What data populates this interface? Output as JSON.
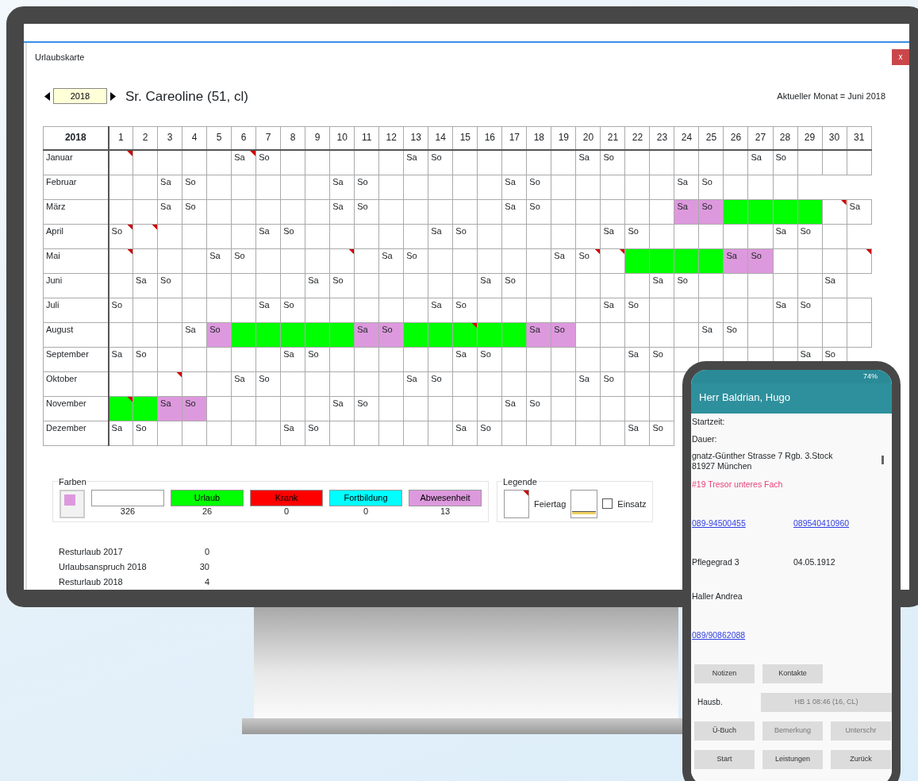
{
  "window": {
    "title": "Urlaubskarte",
    "close": "x"
  },
  "toolbar": {
    "year": "2018",
    "employee": "Sr. Careoline (51, cl)",
    "current_month": "Aktueller Monat = Juni 2018"
  },
  "calendar": {
    "corner": "2018",
    "columns": [
      "1",
      "2",
      "3",
      "4",
      "5",
      "6",
      "7",
      "8",
      "9",
      "10",
      "11",
      "12",
      "13",
      "14",
      "15",
      "16",
      "17",
      "18",
      "19",
      "20",
      "21",
      "22",
      "23",
      "24",
      "25",
      "26",
      "27",
      "28",
      "29",
      "30",
      "31"
    ],
    "months": [
      {
        "name": "Januar",
        "days": [
          {
            "kind": "none",
            "holiday": true
          },
          {
            "kind": "none",
            "holiday": false
          },
          {
            "kind": "none",
            "holiday": false
          },
          {
            "kind": "none",
            "holiday": false
          },
          {
            "kind": "none",
            "holiday": false
          },
          {
            "text": "Sa",
            "kind": "none",
            "holiday": true
          },
          {
            "text": "So",
            "kind": "none",
            "holiday": false
          },
          {
            "kind": "none",
            "holiday": false
          },
          {
            "kind": "none",
            "holiday": false
          },
          {
            "kind": "none",
            "holiday": false
          },
          {
            "kind": "none",
            "holiday": false
          },
          {
            "kind": "none",
            "holiday": false
          },
          {
            "text": "Sa",
            "kind": "none",
            "holiday": false
          },
          {
            "text": "So",
            "kind": "none",
            "holiday": false
          },
          {
            "kind": "none",
            "holiday": false
          },
          {
            "kind": "none",
            "holiday": false
          },
          {
            "kind": "none",
            "holiday": false
          },
          {
            "kind": "none",
            "holiday": false
          },
          {
            "kind": "none",
            "holiday": false
          },
          {
            "text": "Sa",
            "kind": "none",
            "holiday": false
          },
          {
            "text": "So",
            "kind": "none",
            "holiday": false
          },
          {
            "kind": "none",
            "holiday": false
          },
          {
            "kind": "none",
            "holiday": false
          },
          {
            "kind": "none",
            "holiday": false
          },
          {
            "kind": "none",
            "holiday": false
          },
          {
            "kind": "none",
            "holiday": false
          },
          {
            "text": "Sa",
            "kind": "none",
            "holiday": false
          },
          {
            "text": "So",
            "kind": "none",
            "holiday": false
          },
          {
            "kind": "none",
            "holiday": false
          },
          {
            "kind": "none",
            "holiday": false
          },
          {
            "kind": "none",
            "holiday": false
          }
        ]
      },
      {
        "name": "Februar",
        "days": [
          {
            "kind": "none",
            "holiday": false
          },
          {
            "kind": "none",
            "holiday": false
          },
          {
            "text": "Sa",
            "kind": "none",
            "holiday": false
          },
          {
            "text": "So",
            "kind": "none",
            "holiday": false
          },
          {
            "kind": "none",
            "holiday": false
          },
          {
            "kind": "none",
            "holiday": false
          },
          {
            "kind": "none",
            "holiday": false
          },
          {
            "kind": "none",
            "holiday": false
          },
          {
            "kind": "none",
            "holiday": false
          },
          {
            "text": "Sa",
            "kind": "none",
            "holiday": false
          },
          {
            "text": "So",
            "kind": "none",
            "holiday": false
          },
          {
            "kind": "none",
            "holiday": false
          },
          {
            "kind": "none",
            "holiday": false
          },
          {
            "kind": "none",
            "holiday": false
          },
          {
            "kind": "none",
            "holiday": false
          },
          {
            "kind": "none",
            "holiday": false
          },
          {
            "text": "Sa",
            "kind": "none",
            "holiday": false
          },
          {
            "text": "So",
            "kind": "none",
            "holiday": false
          },
          {
            "kind": "none",
            "holiday": false
          },
          {
            "kind": "none",
            "holiday": false
          },
          {
            "kind": "none",
            "holiday": false
          },
          {
            "kind": "none",
            "holiday": false
          },
          {
            "kind": "none",
            "holiday": false
          },
          {
            "text": "Sa",
            "kind": "none",
            "holiday": false
          },
          {
            "text": "So",
            "kind": "none",
            "holiday": false
          },
          {
            "kind": "none",
            "holiday": false
          },
          {
            "kind": "none",
            "holiday": false
          },
          {
            "kind": "none",
            "holiday": false
          }
        ]
      },
      {
        "name": "März",
        "days": [
          {
            "kind": "none",
            "holiday": false
          },
          {
            "kind": "none",
            "holiday": false
          },
          {
            "text": "Sa",
            "kind": "none",
            "holiday": false
          },
          {
            "text": "So",
            "kind": "none",
            "holiday": false
          },
          {
            "kind": "none",
            "holiday": false
          },
          {
            "kind": "none",
            "holiday": false
          },
          {
            "kind": "none",
            "holiday": false
          },
          {
            "kind": "none",
            "holiday": false
          },
          {
            "kind": "none",
            "holiday": false
          },
          {
            "text": "Sa",
            "kind": "none",
            "holiday": false
          },
          {
            "text": "So",
            "kind": "none",
            "holiday": false
          },
          {
            "kind": "none",
            "holiday": false
          },
          {
            "kind": "none",
            "holiday": false
          },
          {
            "kind": "none",
            "holiday": false
          },
          {
            "kind": "none",
            "holiday": false
          },
          {
            "kind": "none",
            "holiday": false
          },
          {
            "text": "Sa",
            "kind": "none",
            "holiday": false
          },
          {
            "text": "So",
            "kind": "none",
            "holiday": false
          },
          {
            "kind": "none",
            "holiday": false
          },
          {
            "kind": "none",
            "holiday": false
          },
          {
            "kind": "none",
            "holiday": false
          },
          {
            "kind": "none",
            "holiday": false
          },
          {
            "kind": "none",
            "holiday": false
          },
          {
            "text": "Sa",
            "kind": "abwesenheit",
            "holiday": false
          },
          {
            "text": "So",
            "kind": "abwesenheit",
            "holiday": false
          },
          {
            "kind": "urlaub",
            "holiday": false
          },
          {
            "kind": "urlaub",
            "holiday": false
          },
          {
            "kind": "urlaub",
            "holiday": false
          },
          {
            "kind": "urlaub",
            "holiday": false
          },
          {
            "kind": "none",
            "holiday": true
          },
          {
            "text": "Sa",
            "kind": "none",
            "holiday": false
          }
        ]
      },
      {
        "name": "April",
        "days": [
          {
            "text": "So",
            "kind": "none",
            "holiday": true
          },
          {
            "kind": "none",
            "holiday": true
          },
          {
            "kind": "none",
            "holiday": false
          },
          {
            "kind": "none",
            "holiday": false
          },
          {
            "kind": "none",
            "holiday": false
          },
          {
            "kind": "none",
            "holiday": false
          },
          {
            "text": "Sa",
            "kind": "none",
            "holiday": false
          },
          {
            "text": "So",
            "kind": "none",
            "holiday": false
          },
          {
            "kind": "none",
            "holiday": false
          },
          {
            "kind": "none",
            "holiday": false
          },
          {
            "kind": "none",
            "holiday": false
          },
          {
            "kind": "none",
            "holiday": false
          },
          {
            "kind": "none",
            "holiday": false
          },
          {
            "text": "Sa",
            "kind": "none",
            "holiday": false
          },
          {
            "text": "So",
            "kind": "none",
            "holiday": false
          },
          {
            "kind": "none",
            "holiday": false
          },
          {
            "kind": "none",
            "holiday": false
          },
          {
            "kind": "none",
            "holiday": false
          },
          {
            "kind": "none",
            "holiday": false
          },
          {
            "kind": "none",
            "holiday": false
          },
          {
            "text": "Sa",
            "kind": "none",
            "holiday": false
          },
          {
            "text": "So",
            "kind": "none",
            "holiday": false
          },
          {
            "kind": "none",
            "holiday": false
          },
          {
            "kind": "none",
            "holiday": false
          },
          {
            "kind": "none",
            "holiday": false
          },
          {
            "kind": "none",
            "holiday": false
          },
          {
            "kind": "none",
            "holiday": false
          },
          {
            "text": "Sa",
            "kind": "none",
            "holiday": false
          },
          {
            "text": "So",
            "kind": "none",
            "holiday": false
          },
          {
            "kind": "none",
            "holiday": false
          }
        ]
      },
      {
        "name": "Mai",
        "days": [
          {
            "kind": "none",
            "holiday": true
          },
          {
            "kind": "none",
            "holiday": false
          },
          {
            "kind": "none",
            "holiday": false
          },
          {
            "kind": "none",
            "holiday": false
          },
          {
            "text": "Sa",
            "kind": "none",
            "holiday": false
          },
          {
            "text": "So",
            "kind": "none",
            "holiday": false
          },
          {
            "kind": "none",
            "holiday": false
          },
          {
            "kind": "none",
            "holiday": false
          },
          {
            "kind": "none",
            "holiday": false
          },
          {
            "kind": "none",
            "holiday": true
          },
          {
            "kind": "none",
            "holiday": false
          },
          {
            "text": "Sa",
            "kind": "none",
            "holiday": false
          },
          {
            "text": "So",
            "kind": "none",
            "holiday": false
          },
          {
            "kind": "none",
            "holiday": false
          },
          {
            "kind": "none",
            "holiday": false
          },
          {
            "kind": "none",
            "holiday": false
          },
          {
            "kind": "none",
            "holiday": false
          },
          {
            "kind": "none",
            "holiday": false
          },
          {
            "text": "Sa",
            "kind": "none",
            "holiday": false
          },
          {
            "text": "So",
            "kind": "none",
            "holiday": true
          },
          {
            "kind": "none",
            "holiday": true
          },
          {
            "kind": "urlaub",
            "holiday": false
          },
          {
            "kind": "urlaub",
            "holiday": false
          },
          {
            "kind": "urlaub",
            "holiday": false
          },
          {
            "kind": "urlaub",
            "holiday": false
          },
          {
            "text": "Sa",
            "kind": "abwesenheit",
            "holiday": false
          },
          {
            "text": "So",
            "kind": "abwesenheit",
            "holiday": false
          },
          {
            "kind": "none",
            "holiday": false
          },
          {
            "kind": "none",
            "holiday": false
          },
          {
            "kind": "none",
            "holiday": false
          },
          {
            "kind": "none",
            "holiday": true
          }
        ]
      },
      {
        "name": "Juni",
        "days": [
          {
            "kind": "none",
            "holiday": false
          },
          {
            "text": "Sa",
            "kind": "none",
            "holiday": false
          },
          {
            "text": "So",
            "kind": "none",
            "holiday": false
          },
          {
            "kind": "none",
            "holiday": false
          },
          {
            "kind": "none",
            "holiday": false
          },
          {
            "kind": "none",
            "holiday": false
          },
          {
            "kind": "none",
            "holiday": false
          },
          {
            "kind": "none",
            "holiday": false
          },
          {
            "text": "Sa",
            "kind": "none",
            "holiday": false
          },
          {
            "text": "So",
            "kind": "none",
            "holiday": false
          },
          {
            "kind": "none",
            "holiday": false
          },
          {
            "kind": "none",
            "holiday": false
          },
          {
            "kind": "none",
            "holiday": false
          },
          {
            "kind": "none",
            "holiday": false
          },
          {
            "kind": "none",
            "holiday": false
          },
          {
            "text": "Sa",
            "kind": "none",
            "holiday": false
          },
          {
            "text": "So",
            "kind": "none",
            "holiday": false
          },
          {
            "kind": "none",
            "holiday": false
          },
          {
            "kind": "none",
            "holiday": false
          },
          {
            "kind": "none",
            "holiday": false
          },
          {
            "kind": "none",
            "holiday": false
          },
          {
            "kind": "none",
            "holiday": false
          },
          {
            "text": "Sa",
            "kind": "none",
            "holiday": false
          },
          {
            "text": "So",
            "kind": "none",
            "holiday": false
          },
          {
            "kind": "none",
            "holiday": false
          },
          {
            "kind": "none",
            "holiday": false
          },
          {
            "kind": "none",
            "holiday": false
          },
          {
            "kind": "none",
            "holiday": false
          },
          {
            "kind": "none",
            "holiday": false
          },
          {
            "text": "Sa",
            "kind": "none",
            "holiday": false
          }
        ]
      },
      {
        "name": "Juli",
        "days": [
          {
            "text": "So",
            "kind": "none",
            "holiday": false
          },
          {
            "kind": "none",
            "holiday": false
          },
          {
            "kind": "none",
            "holiday": false
          },
          {
            "kind": "none",
            "holiday": false
          },
          {
            "kind": "none",
            "holiday": false
          },
          {
            "kind": "none",
            "holiday": false
          },
          {
            "text": "Sa",
            "kind": "none",
            "holiday": false
          },
          {
            "text": "So",
            "kind": "none",
            "holiday": false
          },
          {
            "kind": "none",
            "holiday": false
          },
          {
            "kind": "none",
            "holiday": false
          },
          {
            "kind": "none",
            "holiday": false
          },
          {
            "kind": "none",
            "holiday": false
          },
          {
            "kind": "none",
            "holiday": false
          },
          {
            "text": "Sa",
            "kind": "none",
            "holiday": false
          },
          {
            "text": "So",
            "kind": "none",
            "holiday": false
          },
          {
            "kind": "none",
            "holiday": false
          },
          {
            "kind": "none",
            "holiday": false
          },
          {
            "kind": "none",
            "holiday": false
          },
          {
            "kind": "none",
            "holiday": false
          },
          {
            "kind": "none",
            "holiday": false
          },
          {
            "text": "Sa",
            "kind": "none",
            "holiday": false
          },
          {
            "text": "So",
            "kind": "none",
            "holiday": false
          },
          {
            "kind": "none",
            "holiday": false
          },
          {
            "kind": "none",
            "holiday": false
          },
          {
            "kind": "none",
            "holiday": false
          },
          {
            "kind": "none",
            "holiday": false
          },
          {
            "kind": "none",
            "holiday": false
          },
          {
            "text": "Sa",
            "kind": "none",
            "holiday": false
          },
          {
            "text": "So",
            "kind": "none",
            "holiday": false
          },
          {
            "kind": "none",
            "holiday": false
          },
          {
            "kind": "none",
            "holiday": false
          }
        ]
      },
      {
        "name": "August",
        "days": [
          {
            "kind": "none",
            "holiday": false
          },
          {
            "kind": "none",
            "holiday": false
          },
          {
            "kind": "none",
            "holiday": false
          },
          {
            "text": "Sa",
            "kind": "none",
            "holiday": false
          },
          {
            "text": "So",
            "kind": "abwesenheit",
            "holiday": false
          },
          {
            "kind": "urlaub",
            "holiday": false
          },
          {
            "kind": "urlaub",
            "holiday": false
          },
          {
            "kind": "urlaub",
            "holiday": false
          },
          {
            "kind": "urlaub",
            "holiday": false
          },
          {
            "kind": "urlaub",
            "holiday": false
          },
          {
            "text": "Sa",
            "kind": "abwesenheit",
            "holiday": false
          },
          {
            "text": "So",
            "kind": "abwesenheit",
            "holiday": false
          },
          {
            "kind": "urlaub",
            "holiday": false
          },
          {
            "kind": "urlaub",
            "holiday": false
          },
          {
            "kind": "urlaub",
            "holiday": true
          },
          {
            "kind": "urlaub",
            "holiday": false
          },
          {
            "kind": "urlaub",
            "holiday": false
          },
          {
            "text": "Sa",
            "kind": "abwesenheit",
            "holiday": false
          },
          {
            "text": "So",
            "kind": "abwesenheit",
            "holiday": false
          },
          {
            "kind": "none",
            "holiday": false
          },
          {
            "kind": "none",
            "holiday": false
          },
          {
            "kind": "none",
            "holiday": false
          },
          {
            "kind": "none",
            "holiday": false
          },
          {
            "kind": "none",
            "holiday": false
          },
          {
            "text": "Sa",
            "kind": "none",
            "holiday": false
          },
          {
            "text": "So",
            "kind": "none",
            "holiday": false
          },
          {
            "kind": "none",
            "holiday": false
          },
          {
            "kind": "none",
            "holiday": false
          },
          {
            "kind": "none",
            "holiday": false
          },
          {
            "kind": "none",
            "holiday": false
          },
          {
            "kind": "none",
            "holiday": false
          }
        ]
      },
      {
        "name": "September",
        "days": [
          {
            "text": "Sa",
            "kind": "none",
            "holiday": false
          },
          {
            "text": "So",
            "kind": "none",
            "holiday": false
          },
          {
            "kind": "none",
            "holiday": false
          },
          {
            "kind": "none",
            "holiday": false
          },
          {
            "kind": "none",
            "holiday": false
          },
          {
            "kind": "none",
            "holiday": false
          },
          {
            "kind": "none",
            "holiday": false
          },
          {
            "text": "Sa",
            "kind": "none",
            "holiday": false
          },
          {
            "text": "So",
            "kind": "none",
            "holiday": false
          },
          {
            "kind": "none",
            "holiday": false
          },
          {
            "kind": "none",
            "holiday": false
          },
          {
            "kind": "none",
            "holiday": false
          },
          {
            "kind": "none",
            "holiday": false
          },
          {
            "kind": "none",
            "holiday": false
          },
          {
            "text": "Sa",
            "kind": "none",
            "holiday": false
          },
          {
            "text": "So",
            "kind": "none",
            "holiday": false
          },
          {
            "kind": "none",
            "holiday": false
          },
          {
            "kind": "none",
            "holiday": false
          },
          {
            "kind": "none",
            "holiday": false
          },
          {
            "kind": "none",
            "holiday": false
          },
          {
            "kind": "none",
            "holiday": false
          },
          {
            "text": "Sa",
            "kind": "none",
            "holiday": false
          },
          {
            "text": "So",
            "kind": "none",
            "holiday": false
          },
          {
            "kind": "none",
            "holiday": false
          },
          {
            "kind": "none",
            "holiday": false
          },
          {
            "kind": "none",
            "holiday": false
          },
          {
            "kind": "none",
            "holiday": false
          },
          {
            "kind": "none",
            "holiday": false
          },
          {
            "text": "Sa",
            "kind": "none",
            "holiday": false
          },
          {
            "text": "So",
            "kind": "none",
            "holiday": false
          }
        ]
      },
      {
        "name": "Oktober",
        "days": [
          {
            "kind": "none",
            "holiday": false
          },
          {
            "kind": "none",
            "holiday": false
          },
          {
            "kind": "none",
            "holiday": true
          },
          {
            "kind": "none",
            "holiday": false
          },
          {
            "kind": "none",
            "holiday": false
          },
          {
            "text": "Sa",
            "kind": "none",
            "holiday": false
          },
          {
            "text": "So",
            "kind": "none",
            "holiday": false
          },
          {
            "kind": "none",
            "holiday": false
          },
          {
            "kind": "none",
            "holiday": false
          },
          {
            "kind": "none",
            "holiday": false
          },
          {
            "kind": "none",
            "holiday": false
          },
          {
            "kind": "none",
            "holiday": false
          },
          {
            "text": "Sa",
            "kind": "none",
            "holiday": false
          },
          {
            "text": "So",
            "kind": "none",
            "holiday": false
          },
          {
            "kind": "none",
            "holiday": false
          },
          {
            "kind": "none",
            "holiday": false
          },
          {
            "kind": "none",
            "holiday": false
          },
          {
            "kind": "none",
            "holiday": false
          },
          {
            "kind": "none",
            "holiday": false
          },
          {
            "text": "Sa",
            "kind": "none",
            "holiday": false
          },
          {
            "text": "So",
            "kind": "none",
            "holiday": false
          },
          {
            "kind": "none",
            "holiday": false
          },
          {
            "kind": "none",
            "holiday": false
          },
          {
            "kind": "none",
            "holiday": false
          }
        ]
      },
      {
        "name": "November",
        "days": [
          {
            "kind": "urlaub",
            "holiday": true
          },
          {
            "kind": "urlaub",
            "holiday": false
          },
          {
            "text": "Sa",
            "kind": "abwesenheit",
            "holiday": false
          },
          {
            "text": "So",
            "kind": "abwesenheit",
            "holiday": false
          },
          {
            "kind": "none",
            "holiday": false
          },
          {
            "kind": "none",
            "holiday": false
          },
          {
            "kind": "none",
            "holiday": false
          },
          {
            "kind": "none",
            "holiday": false
          },
          {
            "kind": "none",
            "holiday": false
          },
          {
            "text": "Sa",
            "kind": "none",
            "holiday": false
          },
          {
            "text": "So",
            "kind": "none",
            "holiday": false
          },
          {
            "kind": "none",
            "holiday": false
          },
          {
            "kind": "none",
            "holiday": false
          },
          {
            "kind": "none",
            "holiday": false
          },
          {
            "kind": "none",
            "holiday": false
          },
          {
            "kind": "none",
            "holiday": false
          },
          {
            "text": "Sa",
            "kind": "none",
            "holiday": false
          },
          {
            "text": "So",
            "kind": "none",
            "holiday": false
          },
          {
            "kind": "none",
            "holiday": false
          },
          {
            "kind": "none",
            "holiday": false
          },
          {
            "kind": "none",
            "holiday": false
          },
          {
            "kind": "none",
            "holiday": false
          },
          {
            "kind": "none",
            "holiday": false
          }
        ]
      },
      {
        "name": "Dezember",
        "days": [
          {
            "text": "Sa",
            "kind": "none",
            "holiday": false
          },
          {
            "text": "So",
            "kind": "none",
            "holiday": false
          },
          {
            "kind": "none",
            "holiday": false
          },
          {
            "kind": "none",
            "holiday": false
          },
          {
            "kind": "none",
            "holiday": false
          },
          {
            "kind": "none",
            "holiday": false
          },
          {
            "kind": "none",
            "holiday": false
          },
          {
            "text": "Sa",
            "kind": "none",
            "holiday": false
          },
          {
            "text": "So",
            "kind": "none",
            "holiday": false
          },
          {
            "kind": "none",
            "holiday": false
          },
          {
            "kind": "none",
            "holiday": false
          },
          {
            "kind": "none",
            "holiday": false
          },
          {
            "kind": "none",
            "holiday": false
          },
          {
            "kind": "none",
            "holiday": false
          },
          {
            "text": "Sa",
            "kind": "none",
            "holiday": false
          },
          {
            "text": "So",
            "kind": "none",
            "holiday": false
          },
          {
            "kind": "none",
            "holiday": false
          },
          {
            "kind": "none",
            "holiday": false
          },
          {
            "kind": "none",
            "holiday": false
          },
          {
            "kind": "none",
            "holiday": false
          },
          {
            "kind": "none",
            "holiday": false
          },
          {
            "text": "Sa",
            "kind": "none",
            "holiday": false
          },
          {
            "text": "So",
            "kind": "none",
            "holiday": false
          }
        ]
      }
    ]
  },
  "farben": {
    "title": "Farben",
    "categories": [
      {
        "kind": "frei",
        "color": "#ffffff",
        "count": "326"
      },
      {
        "kind": "urlaub",
        "label": "Urlaub",
        "color": "#00ff00",
        "count": "26"
      },
      {
        "kind": "krank",
        "label": "Krank",
        "color": "#ff0000",
        "count": "0"
      },
      {
        "kind": "fortbildung",
        "label": "Fortbildung",
        "color": "#00ffff",
        "count": "0"
      },
      {
        "kind": "abwesenheit",
        "label": "Abwesenheit",
        "color": "#dd99dd",
        "count": "13"
      }
    ]
  },
  "legende": {
    "title": "Legende",
    "holiday_label": "Feiertag",
    "einsatz_label": "Einsatz",
    "einsatz_checked": false
  },
  "summary": [
    {
      "label": "Resturlaub 2017",
      "value": "0"
    },
    {
      "label": "Urlaubsanspruch 2018",
      "value": "30"
    },
    {
      "label": "Resturlaub 2018",
      "value": "4"
    }
  ],
  "phone": {
    "status_battery": "74%",
    "title": "Herr Baldrian, Hugo",
    "lines": [
      {
        "kind": "plain",
        "text": "Startzeit:"
      },
      {
        "kind": "plain",
        "text": "Dauer:"
      },
      {
        "kind": "address",
        "text": "gnatz-Günther Strasse 7 Rgb. 3.Stock",
        "text2": "81927 München"
      },
      {
        "kind": "note",
        "text": "#19 Tresor unteres Fach"
      },
      {
        "kind": "phones",
        "text": "089-94500455",
        "text2": "089540410960"
      },
      {
        "kind": "pair",
        "text": "Pflegegrad 3",
        "text2": "04.05.1912"
      },
      {
        "kind": "plain",
        "text": "Haller Andrea"
      },
      {
        "kind": "phone",
        "text": "089/90862088"
      }
    ],
    "button_rows": [
      [
        {
          "label": "Notizen",
          "disabled": false
        },
        {
          "label": "Kontakte",
          "disabled": false
        }
      ],
      [
        {
          "kind": "label",
          "label": "Hausb."
        },
        {
          "label": "HB 1 08:46 (16, CL)",
          "disabled": true,
          "wide": true
        }
      ],
      [
        {
          "label": "Ü-Buch",
          "disabled": false
        },
        {
          "label": "Bemerkung",
          "disabled": true
        },
        {
          "label": "Unterschr",
          "disabled": true
        }
      ],
      [
        {
          "label": "Start",
          "disabled": false
        },
        {
          "label": "Leistungen",
          "disabled": false
        },
        {
          "label": "Zurück",
          "disabled": false
        }
      ]
    ]
  }
}
